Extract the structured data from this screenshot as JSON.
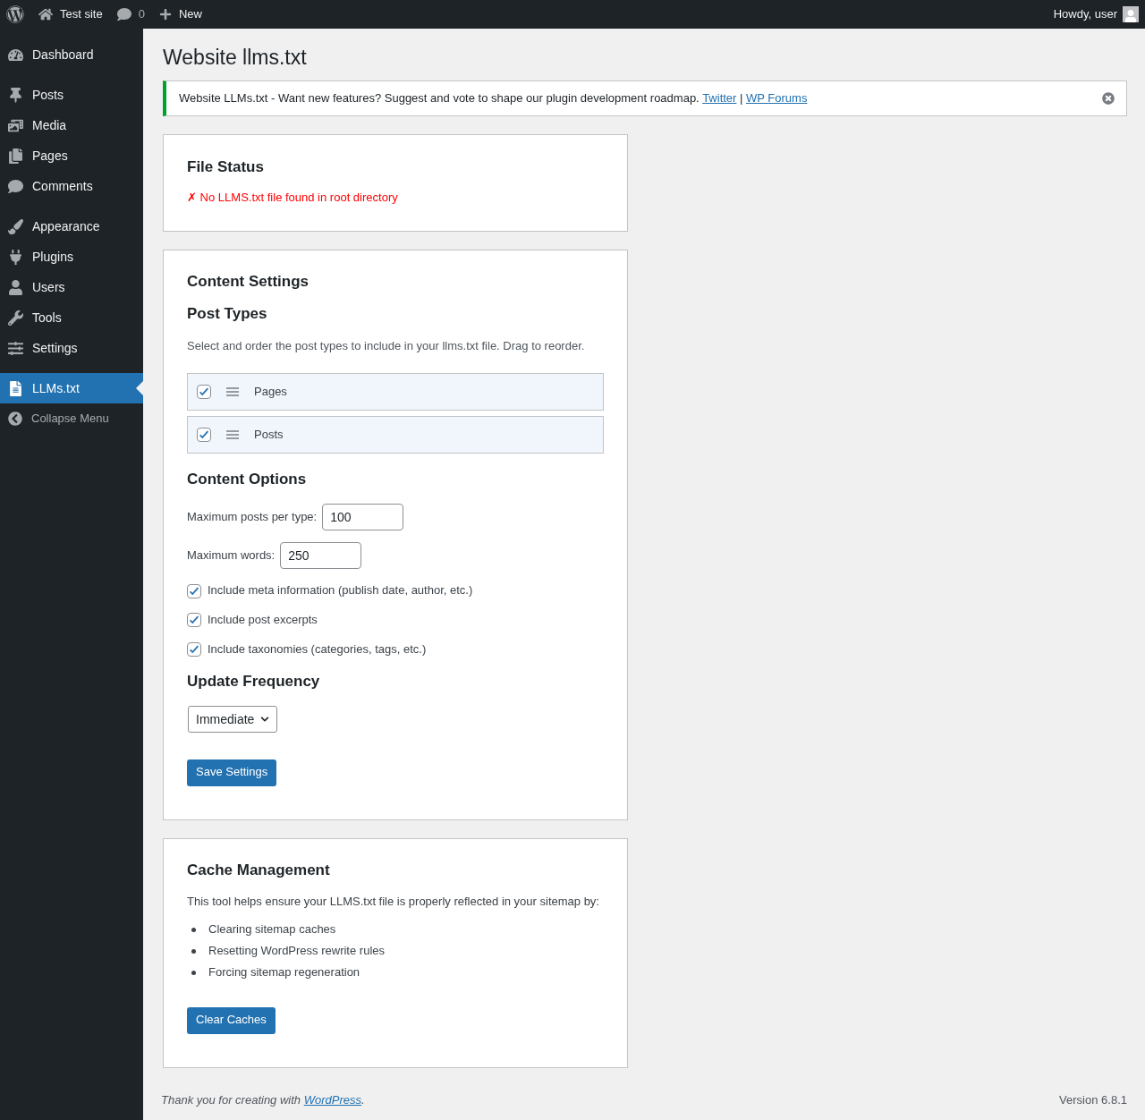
{
  "admin_bar": {
    "site": "Test site",
    "comments": "0",
    "new": "New",
    "greeting": "Howdy, user"
  },
  "sidebar": {
    "groups": [
      {
        "items": [
          {
            "label": "Dashboard",
            "selected": false
          }
        ]
      },
      {
        "items": [
          {
            "label": "Posts",
            "selected": false
          },
          {
            "label": "Media",
            "selected": false
          },
          {
            "label": "Pages",
            "selected": false
          },
          {
            "label": "Comments",
            "selected": false
          }
        ]
      },
      {
        "items": [
          {
            "label": "Appearance",
            "selected": false
          },
          {
            "label": "Plugins",
            "selected": false
          },
          {
            "label": "Users",
            "selected": false
          },
          {
            "label": "Tools",
            "selected": false
          },
          {
            "label": "Settings",
            "selected": false
          }
        ]
      },
      {
        "items": [
          {
            "label": "LLMs.txt",
            "selected": true
          }
        ]
      }
    ],
    "collapse": "Collapse Menu"
  },
  "page_title": "Website llms.txt",
  "notice": {
    "text": "Website LLMs.txt - Want new features? Suggest and vote to shape our plugin development roadmap.",
    "links": [
      "Twitter",
      "WP Forums"
    ],
    "separator": "|"
  },
  "file_status": {
    "title": "File Status",
    "message": "✗ No LLMS.txt file found in root directory"
  },
  "content_settings": {
    "title": "Content Settings",
    "post_types_title": "Post Types",
    "post_types_hint": "Select and order the post types to include in your llms.txt file. Drag to reorder.",
    "post_types": [
      {
        "label": "Pages",
        "checked": true
      },
      {
        "label": "Posts",
        "checked": true
      }
    ],
    "options_title": "Content Options",
    "fields": [
      {
        "label": "Maximum posts per type:",
        "value": "100"
      },
      {
        "label": "Maximum words:",
        "value": "250"
      }
    ],
    "options": [
      {
        "label": "Include meta information (publish date, author, etc.)",
        "checked": true
      },
      {
        "label": "Include post excerpts",
        "checked": true
      },
      {
        "label": "Include taxonomies (categories, tags, etc.)",
        "checked": true
      }
    ],
    "frequency_title": "Update Frequency",
    "frequency": "Immediate",
    "save": "Save Settings"
  },
  "cache": {
    "title": "Cache Management",
    "intro": "This tool helps ensure your LLMS.txt file is properly reflected in your sitemap by:",
    "items": [
      "Clearing sitemap caches",
      "Resetting WordPress rewrite rules",
      "Forcing sitemap regeneration"
    ],
    "button": "Clear Caches"
  },
  "footer": {
    "text": "Thank you for creating with",
    "link": "WordPress",
    "end": ".",
    "version": "Version 6.8.1"
  }
}
